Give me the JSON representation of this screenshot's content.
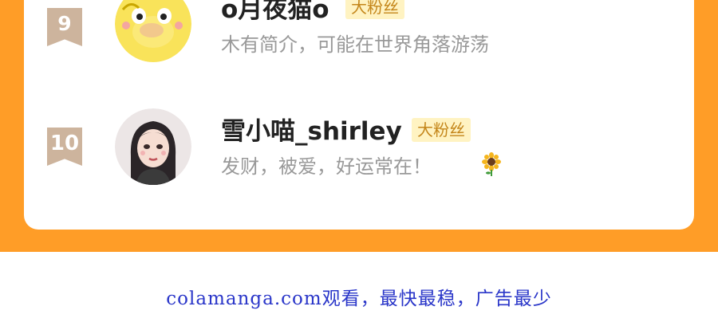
{
  "ranking": {
    "entries": [
      {
        "rank": "9",
        "name": "o月夜猫o",
        "badge": "大粉丝",
        "bio": "木有简介，可能在世界角落游荡",
        "avatar_icon": "yellow-duck-avatar"
      },
      {
        "rank": "10",
        "name": "雪小喵_shirley",
        "badge": "大粉丝",
        "bio": "发财，被爱，好运常在！",
        "bio_emoji": "sunflower-icon",
        "avatar_icon": "girl-portrait-avatar"
      }
    ]
  },
  "footer": {
    "text": "colamanga.com观看，最快最稳，广告最少"
  },
  "colors": {
    "accent_orange": "#ff9d27",
    "badge_bg": "#fff3c2",
    "badge_text": "#c4861a",
    "footer_link": "#2a36c9"
  }
}
